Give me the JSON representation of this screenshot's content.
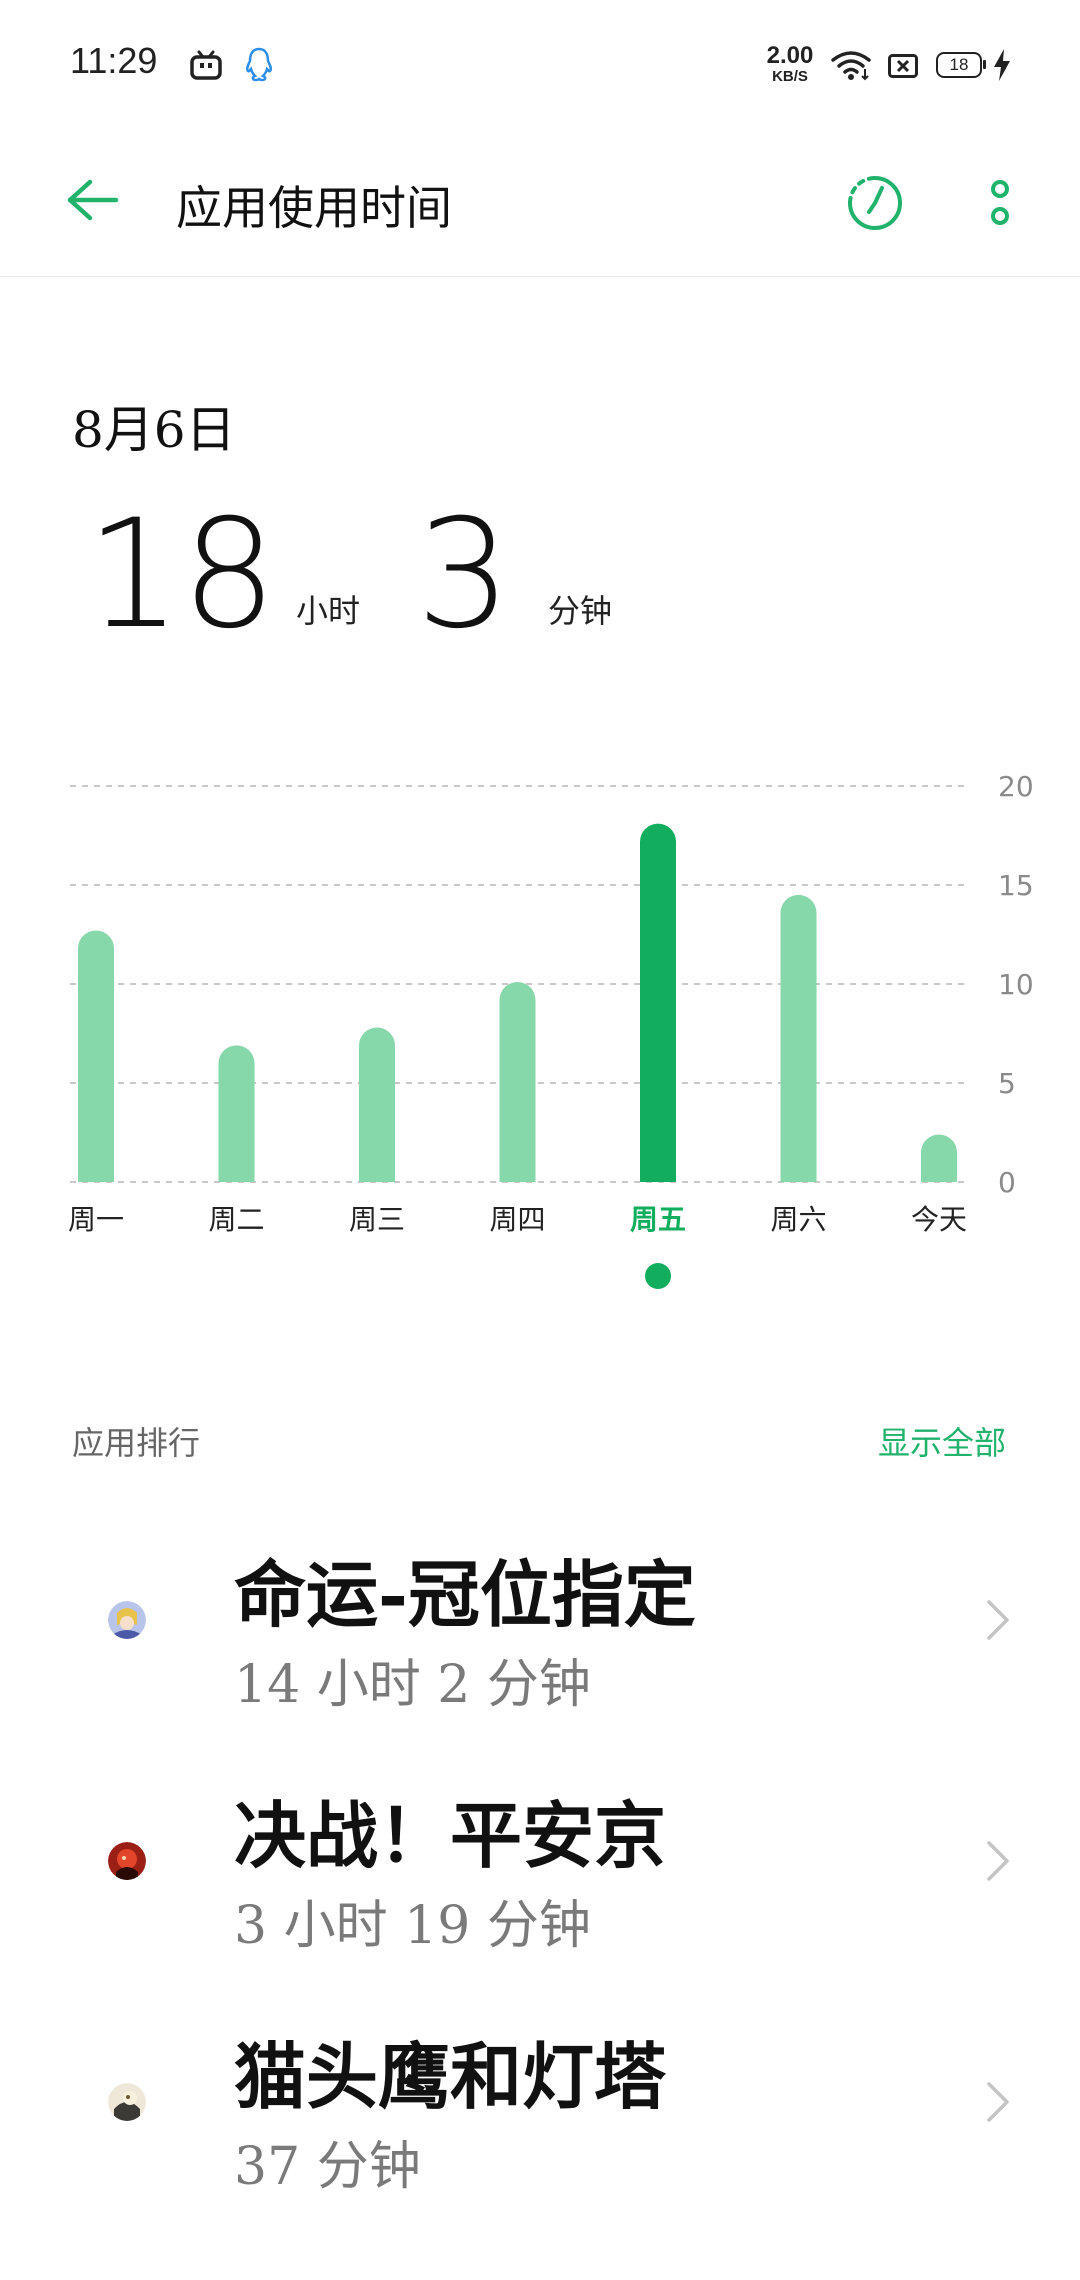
{
  "status_bar": {
    "time": "11:29",
    "net_speed_value": "2.00",
    "net_speed_unit": "KB/S",
    "battery_level": "18",
    "icons": [
      "bilibili-icon",
      "qq-icon",
      "wifi-icon",
      "sim-off-icon",
      "battery-icon",
      "charging-bolt-icon"
    ]
  },
  "app_bar": {
    "title": "应用使用时间",
    "icons": [
      "back-arrow-icon",
      "timer-icon",
      "more-options-icon"
    ]
  },
  "summary": {
    "date": "8月6日",
    "hours": "18",
    "hours_unit": "小时",
    "minutes": "3",
    "minutes_unit": "分钟"
  },
  "colors": {
    "accent": "#21b26c",
    "bar_selected": "#12ad5d",
    "bar_default": "#86d7aa",
    "grid": "#c8c8c8",
    "secondary_text": "#7a7a7a"
  },
  "chart_data": {
    "type": "bar",
    "categories": [
      "周一",
      "周二",
      "周三",
      "周四",
      "周五",
      "周六",
      "今天"
    ],
    "values": [
      12.7,
      6.9,
      7.8,
      10.1,
      18.1,
      14.5,
      2.4
    ],
    "ylim": [
      0,
      20
    ],
    "yticks": [
      "0",
      "5",
      "10",
      "15",
      "20"
    ],
    "y_axis_position": "right",
    "grid": true,
    "selected_index": 4
  },
  "ranking": {
    "label": "应用排行",
    "show_all": "显示全部",
    "apps": [
      {
        "name": "命运-冠位指定",
        "time": "14 小时 2 分钟",
        "icon": "fgo-app-icon"
      },
      {
        "name": "决战！平安京",
        "time": "3 小时 19 分钟",
        "icon": "onmyoji-arena-app-icon"
      },
      {
        "name": "猫头鹰和灯塔",
        "time": "37 分钟",
        "icon": "owl-lighthouse-app-icon"
      }
    ]
  }
}
